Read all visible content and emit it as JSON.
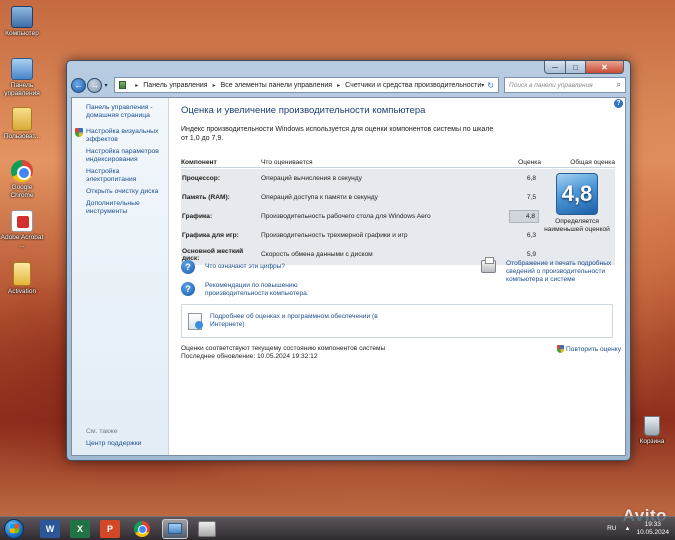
{
  "desktop": {
    "icons": [
      {
        "label": "Компьютер",
        "icon": "computer-icon"
      },
      {
        "label": "Панель управления",
        "icon": "control-panel-icon"
      },
      {
        "label": "Пользоват...",
        "icon": "user-folder-icon"
      },
      {
        "label": "Google Chrome",
        "icon": "chrome-icon"
      },
      {
        "label": "Adobe Acrobat ...",
        "icon": "adobe-acrobat-icon"
      },
      {
        "label": "Activation",
        "icon": "activation-file-icon"
      },
      {
        "label": "Корзина",
        "icon": "recycle-bin-icon"
      }
    ],
    "watermark": "Avito"
  },
  "window": {
    "controls": {
      "minimize": "─",
      "maximize": "□",
      "close": "✕"
    },
    "nav": {
      "back": "←",
      "forward": "→",
      "dropdown": "▾"
    },
    "breadcrumb": [
      "Панель управления",
      "Все элементы панели управления",
      "Счетчики и средства производительности"
    ],
    "breadcrumb_sep": "▸",
    "address_dropdown": "▾",
    "refresh": "↻",
    "search_placeholder": "Поиск в панели управления",
    "search_icon": "⌕",
    "sidebar": {
      "home": "Панель управления - домашняя страница",
      "items": [
        "Настройка визуальных эффектов",
        "Настройка параметров индексирования",
        "Настройка электропитания",
        "Открыть очистку диска",
        "Дополнительные инструменты"
      ],
      "see_also": "См. также",
      "support": "Центр поддержки"
    },
    "main": {
      "help": "?",
      "title": "Оценка и увеличение производительности компьютера",
      "description": "Индекс производительности Windows используется для оценки компонентов системы по шкале от 1,0 до 7,9.",
      "table": {
        "headers": [
          "Компонент",
          "Что оценивается",
          "Оценка",
          "Общая оценка"
        ],
        "rows": [
          {
            "component": "Процессор:",
            "what": "Операций вычисления в секунду",
            "score": "6,8"
          },
          {
            "component": "Память (RAM):",
            "what": "Операций доступа к памяти в секунду",
            "score": "7,5"
          },
          {
            "component": "Графика:",
            "what": "Производительность рабочего стола для Windows Aero",
            "score": "4,8"
          },
          {
            "component": "Графика для игр:",
            "what": "Производительность трехмерной графики и игр",
            "score": "6,3"
          },
          {
            "component": "Основной жесткий диск:",
            "what": "Скорость обмена данными с диском",
            "score": "5,9"
          }
        ],
        "base_score": "4,8",
        "base_caption": "Определяется наименьшей оценкой"
      },
      "links": {
        "what_mean": "Что означают эти цифры?",
        "tips": "Рекомендации по повышению производительности компьютера.",
        "print": "Отображение и печать подробных сведений о производительности компьютера и системе",
        "more_info": "Подробнее об оценках и программном обеспечении (в Интернете)"
      },
      "status": {
        "line1": "Оценки соответствуют текущему состоянию компонентов системы",
        "line2": "Последнее обновление: 10.05.2024 19:32:12"
      },
      "retry": "Повторить оценку"
    }
  },
  "taskbar": {
    "apps": [
      {
        "name": "word",
        "label": "W"
      },
      {
        "name": "excel",
        "label": "X"
      },
      {
        "name": "powerpoint",
        "label": "P"
      }
    ],
    "language": "RU",
    "tray_arrow": "▲",
    "time": "19:33",
    "date": "10.05.2024"
  },
  "colors": {
    "link": "#1c4f8f",
    "title": "#1c3f73",
    "score_tile": "#4b97d6",
    "table_bg": "#e6e9ed"
  }
}
